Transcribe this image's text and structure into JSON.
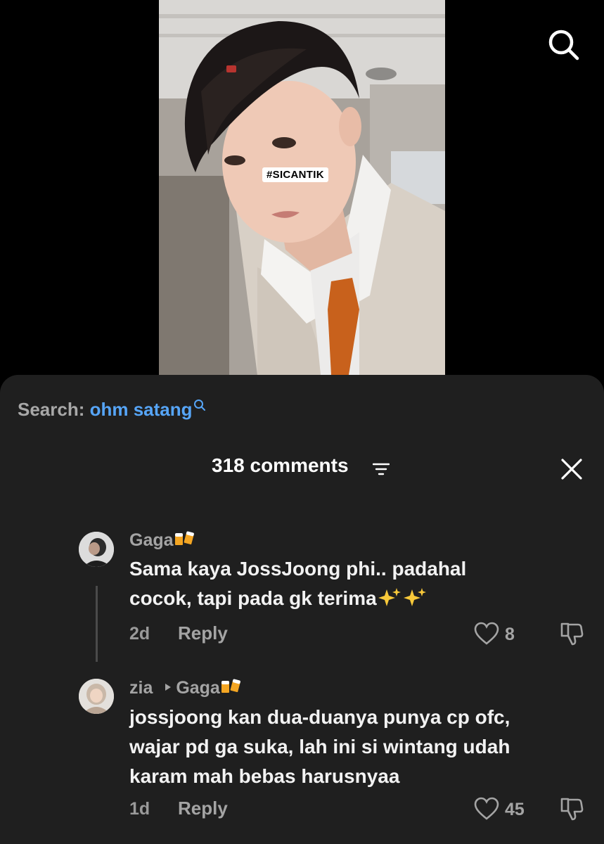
{
  "video": {
    "hashtag": "#SICANTIK"
  },
  "search": {
    "prefix": "Search: ",
    "query": "ohm satang"
  },
  "comments_panel": {
    "count_label": "318 comments"
  },
  "comments": [
    {
      "username": "Gaga",
      "username_emoji": "beer-mugs",
      "text_line1": "Sama kaya JossJoong phi.. padahal",
      "text_line2": "cocok, tapi pada gk terima",
      "text_emoji": "sparkles",
      "time": "2d",
      "reply_label": "Reply",
      "likes": "8"
    },
    {
      "username": "zia",
      "reply_to": "Gaga",
      "reply_to_emoji": "beer-mugs",
      "text_line1": "jossjoong kan dua-duanya punya cp ofc,",
      "text_line2": "wajar pd ga suka, lah ini si wintang udah",
      "text_line3": "karam mah bebas harusnyaa",
      "time": "1d",
      "reply_label": "Reply",
      "likes": "45"
    }
  ],
  "colors": {
    "sheet_bg": "#1f1f1f",
    "link_blue": "#56a5f7",
    "muted": "#a4a4a4"
  }
}
